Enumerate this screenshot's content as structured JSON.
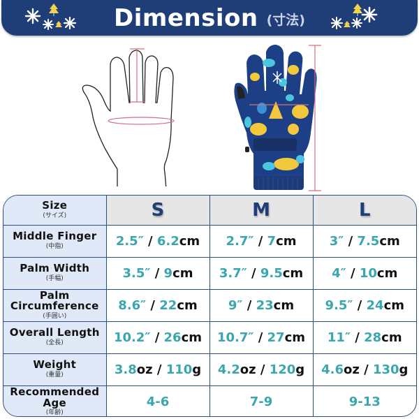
{
  "banner": {
    "title": "Dimension",
    "subtitle": "(寸法)",
    "decorations": [
      "snowflake-icon",
      "tree-icon"
    ]
  },
  "figures": {
    "hand": {
      "name": "hand-outline-diagram",
      "measure_marks": [
        "middle-finger-length",
        "palm-circumference"
      ]
    },
    "glove": {
      "name": "kids-ski-glove-photo",
      "measure_marks": [
        "overall-length",
        "palm-width"
      ]
    }
  },
  "colors": {
    "banner": "#1f3e78",
    "accent_teal": "#3aa6ad",
    "label_bg": "#dfe9f8",
    "header_bg": "#e6e6e6",
    "measure_line": "#d4707e"
  },
  "table": {
    "size_label": {
      "main": "Size",
      "sub": "(サイズ)"
    },
    "sizes": [
      "S",
      "M",
      "L"
    ],
    "rows": [
      {
        "label": "Middle Finger",
        "sub": "(中指)",
        "cells": [
          {
            "a": "2.5″",
            "sep": " / ",
            "b": "6.2",
            "unit": "cm"
          },
          {
            "a": "2.7″",
            "sep": " / ",
            "b": "7",
            "unit": "cm"
          },
          {
            "a": "3″",
            "sep": " / ",
            "b": "7.5",
            "unit": "cm"
          }
        ]
      },
      {
        "label": "Palm Width",
        "sub": "(手幅)",
        "cells": [
          {
            "a": "3.5″",
            "sep": " / ",
            "b": "9",
            "unit": "cm"
          },
          {
            "a": "3.7″",
            "sep": " / ",
            "b": "9.5",
            "unit": "cm"
          },
          {
            "a": "4″",
            "sep": " / ",
            "b": "10",
            "unit": "cm"
          }
        ]
      },
      {
        "label": "Palm Circumference",
        "label_line1": "Palm",
        "label_line2": "Circumference",
        "sub": "(手囲い)",
        "cells": [
          {
            "a": "8.6″",
            "sep": " / ",
            "b": "22",
            "unit": "cm"
          },
          {
            "a": "9″",
            "sep": " / ",
            "b": "23",
            "unit": "cm"
          },
          {
            "a": "9.5″",
            "sep": " / ",
            "b": "24",
            "unit": "cm"
          }
        ]
      },
      {
        "label": "Overall Length",
        "sub": "(全長)",
        "cells": [
          {
            "a": "10.2″",
            "sep": " / ",
            "b": "26",
            "unit": "cm"
          },
          {
            "a": "10.7″",
            "sep": " / ",
            "b": "27",
            "unit": "cm"
          },
          {
            "a": "11″",
            "sep": " / ",
            "b": "28",
            "unit": "cm"
          }
        ]
      },
      {
        "label": "Weight",
        "sub": "(重量)",
        "cells": [
          {
            "a": "3.8",
            "a_unit": "oz",
            "sep": " / ",
            "b": "110",
            "unit": "g"
          },
          {
            "a": "4.2",
            "a_unit": "oz",
            "sep": " / ",
            "b": "120",
            "unit": "g"
          },
          {
            "a": "4.6",
            "a_unit": "oz",
            "sep": " / ",
            "b": "130",
            "unit": "g"
          }
        ]
      },
      {
        "label": "Recommended Age",
        "label_line1": "Recommended",
        "label_line2": "Age",
        "sub": "(年齢)",
        "ages": [
          "4-6",
          "7-9",
          "9-13"
        ]
      }
    ]
  }
}
